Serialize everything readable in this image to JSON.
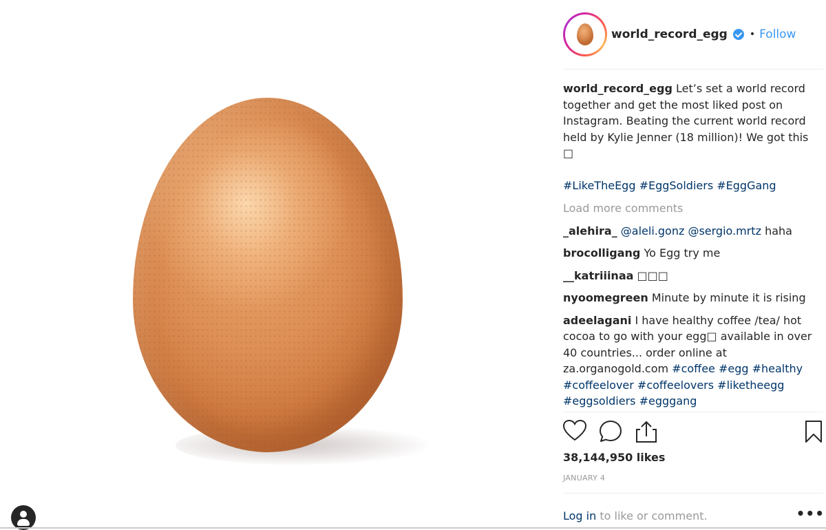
{
  "post": {
    "username": "world_record_egg",
    "follow_label": "Follow",
    "dot": "•",
    "caption_user": "world_record_egg",
    "caption_text": "Let’s set a world record together and get the most liked post on Instagram. Beating the current world record held by Kylie Jenner (18 million)! We got this □",
    "caption_tags": "#LikeTheEgg #EggSoldiers #EggGang"
  },
  "load_more": "Load more comments",
  "comments": [
    {
      "user": "_alehira_",
      "mention1": "@aleli.gonz",
      "mention2": "@sergio.mrtz",
      "text": "haha"
    },
    {
      "user": "brocolligang",
      "text": "Yo Egg try me"
    },
    {
      "user": "__katriiinaa",
      "text": "□□□"
    },
    {
      "user": "nyoomegreen",
      "text": "Minute by minute it is rising"
    },
    {
      "user": "adeelagani",
      "text": "I have healthy coffee /tea/ hot cocoa to go with your egg□ available in over 40 countries... order online at za.organogold.com",
      "tags": "#coffee #egg #healthy #coffeelover #coffeelovers #liketheegg #eggsoldiers #egggang"
    }
  ],
  "likes": "38,144,950 likes",
  "date": "JANUARY 4",
  "login_link": "Log in",
  "login_text": "to like or comment.",
  "more_label": "•••",
  "icons": {
    "like": "heart-icon",
    "comment": "comment-icon",
    "share": "share-icon",
    "save": "bookmark-icon",
    "user": "user-avatar-icon",
    "verified": "verified-badge-icon"
  },
  "colors": {
    "link": "#003569",
    "follow": "#3897f0",
    "muted": "#999999",
    "egg": "#dd8f55"
  }
}
